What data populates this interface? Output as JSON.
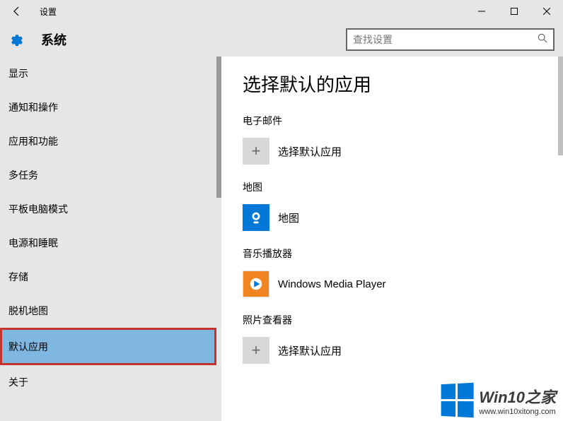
{
  "window": {
    "title": "设置"
  },
  "header": {
    "title": "系统"
  },
  "search": {
    "placeholder": "查找设置"
  },
  "sidebar": {
    "items": [
      {
        "label": "显示"
      },
      {
        "label": "通知和操作"
      },
      {
        "label": "应用和功能"
      },
      {
        "label": "多任务"
      },
      {
        "label": "平板电脑模式"
      },
      {
        "label": "电源和睡眠"
      },
      {
        "label": "存储"
      },
      {
        "label": "脱机地图"
      },
      {
        "label": "默认应用"
      },
      {
        "label": "关于"
      }
    ]
  },
  "main": {
    "title": "选择默认的应用",
    "sections": {
      "email": {
        "label": "电子邮件",
        "choose": "选择默认应用"
      },
      "maps": {
        "label": "地图",
        "app": "地图"
      },
      "music": {
        "label": "音乐播放器",
        "app": "Windows Media Player"
      },
      "photos": {
        "label": "照片查看器",
        "choose": "选择默认应用"
      }
    }
  },
  "watermark": {
    "line1": "Win10之家",
    "line2": "www.win10xitong.com"
  }
}
